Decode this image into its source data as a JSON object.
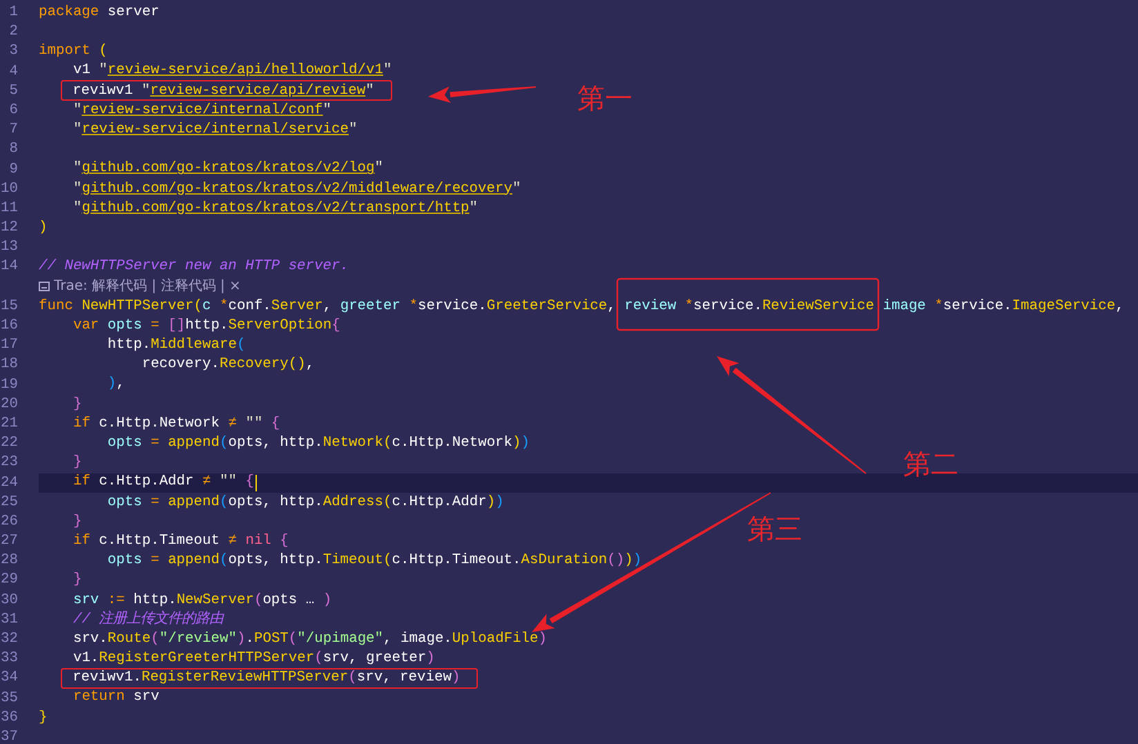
{
  "editor": {
    "lines": [
      {
        "kind": "code",
        "number": "1",
        "current": false,
        "tokens": [
          {
            "kind": "kw",
            "text": "package"
          },
          {
            "kind": "id",
            "text": " server"
          }
        ]
      },
      {
        "kind": "code",
        "number": "2",
        "current": false
      },
      {
        "kind": "code",
        "number": "3",
        "current": false,
        "tokens": [
          {
            "kind": "kw",
            "text": "import"
          },
          {
            "kind": "b1",
            "text": " ("
          }
        ]
      },
      {
        "kind": "code",
        "number": "4",
        "current": false,
        "tokens": [
          {
            "kind": "id",
            "text": "    v1 "
          },
          {
            "kind": "q",
            "text": "\""
          },
          {
            "kind": "link",
            "text": "review-service/api/helloworld/v1"
          },
          {
            "kind": "q",
            "text": "\""
          }
        ]
      },
      {
        "kind": "code",
        "number": "5",
        "current": false,
        "tokens": [
          {
            "kind": "id",
            "text": "    reviwv1 "
          },
          {
            "kind": "q",
            "text": "\""
          },
          {
            "kind": "link",
            "text": "review-service/api/review"
          },
          {
            "kind": "q",
            "text": "\""
          }
        ]
      },
      {
        "kind": "code",
        "number": "6",
        "current": false,
        "tokens": [
          {
            "kind": "q",
            "text": "    \""
          },
          {
            "kind": "link",
            "text": "review-service/internal/conf"
          },
          {
            "kind": "q",
            "text": "\""
          }
        ]
      },
      {
        "kind": "code",
        "number": "7",
        "current": false,
        "tokens": [
          {
            "kind": "q",
            "text": "    \""
          },
          {
            "kind": "link",
            "text": "review-service/internal/service"
          },
          {
            "kind": "q",
            "text": "\""
          }
        ]
      },
      {
        "kind": "code",
        "number": "8",
        "current": false
      },
      {
        "kind": "code",
        "number": "9",
        "current": false,
        "tokens": [
          {
            "kind": "q",
            "text": "    \""
          },
          {
            "kind": "link",
            "text": "github.com/go-kratos/kratos/v2/log"
          },
          {
            "kind": "q",
            "text": "\""
          }
        ]
      },
      {
        "kind": "code",
        "number": "10",
        "current": false,
        "tokens": [
          {
            "kind": "q",
            "text": "    \""
          },
          {
            "kind": "link",
            "text": "github.com/go-kratos/kratos/v2/middleware/recovery"
          },
          {
            "kind": "q",
            "text": "\""
          }
        ]
      },
      {
        "kind": "code",
        "number": "11",
        "current": false,
        "tokens": [
          {
            "kind": "q",
            "text": "    \""
          },
          {
            "kind": "link",
            "text": "github.com/go-kratos/kratos/v2/transport/http"
          },
          {
            "kind": "q",
            "text": "\""
          }
        ]
      },
      {
        "kind": "code",
        "number": "12",
        "current": false,
        "tokens": [
          {
            "kind": "b1",
            "text": ")"
          }
        ]
      },
      {
        "kind": "code",
        "number": "13",
        "current": false
      },
      {
        "kind": "code",
        "number": "14",
        "current": false,
        "tokens": [
          {
            "kind": "cm",
            "text": "// NewHTTPServer new an HTTP server."
          }
        ]
      },
      {
        "kind": "codelens",
        "text": "Trae: 解释代码 | 注释代码 | ×"
      },
      {
        "kind": "code",
        "number": "15",
        "current": false,
        "tokens": [
          {
            "kind": "kw",
            "text": "func"
          },
          {
            "kind": "fn",
            "text": " NewHTTPServer"
          },
          {
            "kind": "b1",
            "text": "("
          },
          {
            "kind": "var",
            "text": "c "
          },
          {
            "kind": "op",
            "text": "*"
          },
          {
            "kind": "id",
            "text": "conf."
          },
          {
            "kind": "fn",
            "text": "Server"
          },
          {
            "kind": "id",
            "text": ", "
          },
          {
            "kind": "var",
            "text": "greeter "
          },
          {
            "kind": "op",
            "text": "*"
          },
          {
            "kind": "id",
            "text": "service."
          },
          {
            "kind": "fn",
            "text": "GreeterService"
          },
          {
            "kind": "id",
            "text": ", "
          },
          {
            "kind": "var",
            "text": "review "
          },
          {
            "kind": "op",
            "text": "*"
          },
          {
            "kind": "id",
            "text": "service."
          },
          {
            "kind": "fn",
            "text": "ReviewService"
          },
          {
            "kind": "var",
            "text": " image "
          },
          {
            "kind": "op",
            "text": "*"
          },
          {
            "kind": "id",
            "text": "service."
          },
          {
            "kind": "fn",
            "text": "ImageService"
          },
          {
            "kind": "id",
            "text": ","
          }
        ]
      },
      {
        "kind": "code",
        "number": "16",
        "current": false,
        "tokens": [
          {
            "kind": "kw",
            "text": "    var"
          },
          {
            "kind": "var",
            "text": " opts "
          },
          {
            "kind": "op",
            "text": "="
          },
          {
            "kind": "b2",
            "text": " []"
          },
          {
            "kind": "id",
            "text": "http."
          },
          {
            "kind": "fn",
            "text": "ServerOption"
          },
          {
            "kind": "b2",
            "text": "{"
          }
        ]
      },
      {
        "kind": "code",
        "number": "17",
        "current": false,
        "tokens": [
          {
            "kind": "id",
            "text": "        http."
          },
          {
            "kind": "fn",
            "text": "Middleware"
          },
          {
            "kind": "b3",
            "text": "("
          }
        ]
      },
      {
        "kind": "code",
        "number": "18",
        "current": false,
        "tokens": [
          {
            "kind": "id",
            "text": "            recovery."
          },
          {
            "kind": "fn",
            "text": "Recovery"
          },
          {
            "kind": "b1",
            "text": "()"
          },
          {
            "kind": "id",
            "text": ","
          }
        ]
      },
      {
        "kind": "code",
        "number": "19",
        "current": false,
        "tokens": [
          {
            "kind": "b3",
            "text": "        )"
          },
          {
            "kind": "id",
            "text": ","
          }
        ]
      },
      {
        "kind": "code",
        "number": "20",
        "current": false,
        "tokens": [
          {
            "kind": "b2",
            "text": "    }"
          }
        ]
      },
      {
        "kind": "code",
        "number": "21",
        "current": false,
        "tokens": [
          {
            "kind": "kw",
            "text": "    if"
          },
          {
            "kind": "id",
            "text": " c.Http.Network "
          },
          {
            "kind": "op",
            "text": "≠"
          },
          {
            "kind": "q",
            "text": " \"\" "
          },
          {
            "kind": "b2",
            "text": "{"
          }
        ]
      },
      {
        "kind": "code",
        "number": "22",
        "current": false,
        "tokens": [
          {
            "kind": "var",
            "text": "        opts "
          },
          {
            "kind": "op",
            "text": "="
          },
          {
            "kind": "fn",
            "text": " append"
          },
          {
            "kind": "b3",
            "text": "("
          },
          {
            "kind": "id",
            "text": "opts, http."
          },
          {
            "kind": "fn",
            "text": "Network"
          },
          {
            "kind": "b1",
            "text": "("
          },
          {
            "kind": "id",
            "text": "c.Http.Network"
          },
          {
            "kind": "b1",
            "text": ")"
          },
          {
            "kind": "b3",
            "text": ")"
          }
        ]
      },
      {
        "kind": "code",
        "number": "23",
        "current": false,
        "tokens": [
          {
            "kind": "b2",
            "text": "    }"
          }
        ]
      },
      {
        "kind": "code",
        "number": "24",
        "current": true,
        "tokens": [
          {
            "kind": "kw",
            "text": "    if"
          },
          {
            "kind": "id",
            "text": " c.Http.Addr "
          },
          {
            "kind": "op",
            "text": "≠"
          },
          {
            "kind": "q",
            "text": " \"\" "
          },
          {
            "kind": "b2",
            "text": "{"
          }
        ]
      },
      {
        "kind": "code",
        "number": "25",
        "current": false,
        "tokens": [
          {
            "kind": "var",
            "text": "        opts "
          },
          {
            "kind": "op",
            "text": "="
          },
          {
            "kind": "fn",
            "text": " append"
          },
          {
            "kind": "b3",
            "text": "("
          },
          {
            "kind": "id",
            "text": "opts, http."
          },
          {
            "kind": "fn",
            "text": "Address"
          },
          {
            "kind": "b1",
            "text": "("
          },
          {
            "kind": "id",
            "text": "c.Http.Addr"
          },
          {
            "kind": "b1",
            "text": ")"
          },
          {
            "kind": "b3",
            "text": ")"
          }
        ]
      },
      {
        "kind": "code",
        "number": "26",
        "current": false,
        "tokens": [
          {
            "kind": "b2",
            "text": "    }"
          }
        ]
      },
      {
        "kind": "code",
        "number": "27",
        "current": false,
        "tokens": [
          {
            "kind": "kw",
            "text": "    if"
          },
          {
            "kind": "id",
            "text": " c.Http.Timeout "
          },
          {
            "kind": "op",
            "text": "≠"
          },
          {
            "kind": "nil",
            "text": " nil"
          },
          {
            "kind": "b2",
            "text": " {"
          }
        ]
      },
      {
        "kind": "code",
        "number": "28",
        "current": false,
        "tokens": [
          {
            "kind": "var",
            "text": "        opts "
          },
          {
            "kind": "op",
            "text": "="
          },
          {
            "kind": "fn",
            "text": " append"
          },
          {
            "kind": "b3",
            "text": "("
          },
          {
            "kind": "id",
            "text": "opts, http."
          },
          {
            "kind": "fn",
            "text": "Timeout"
          },
          {
            "kind": "b1",
            "text": "("
          },
          {
            "kind": "id",
            "text": "c.Http.Timeout."
          },
          {
            "kind": "fn",
            "text": "AsDuration"
          },
          {
            "kind": "b2",
            "text": "()"
          },
          {
            "kind": "b1",
            "text": ")"
          },
          {
            "kind": "b3",
            "text": ")"
          }
        ]
      },
      {
        "kind": "code",
        "number": "29",
        "current": false,
        "tokens": [
          {
            "kind": "b2",
            "text": "    }"
          }
        ]
      },
      {
        "kind": "code",
        "number": "30",
        "current": false,
        "tokens": [
          {
            "kind": "var",
            "text": "    srv "
          },
          {
            "kind": "op",
            "text": ":="
          },
          {
            "kind": "id",
            "text": " http."
          },
          {
            "kind": "fn",
            "text": "NewServer"
          },
          {
            "kind": "b2",
            "text": "("
          },
          {
            "kind": "id",
            "text": "opts … "
          },
          {
            "kind": "b2",
            "text": ")"
          }
        ]
      },
      {
        "kind": "code",
        "number": "31",
        "current": false,
        "tokens": [
          {
            "kind": "cm",
            "text": "    // 注册上传文件的路由"
          }
        ]
      },
      {
        "kind": "code",
        "number": "32",
        "current": false,
        "tokens": [
          {
            "kind": "id",
            "text": "    srv."
          },
          {
            "kind": "fn",
            "text": "Route"
          },
          {
            "kind": "b2",
            "text": "("
          },
          {
            "kind": "str",
            "text": "\"/review\""
          },
          {
            "kind": "b2",
            "text": ")"
          },
          {
            "kind": "id",
            "text": "."
          },
          {
            "kind": "fn",
            "text": "POST"
          },
          {
            "kind": "b2",
            "text": "("
          },
          {
            "kind": "str",
            "text": "\"/upimage\""
          },
          {
            "kind": "id",
            "text": ", image."
          },
          {
            "kind": "fn",
            "text": "UploadFile"
          },
          {
            "kind": "b2",
            "text": ")"
          }
        ]
      },
      {
        "kind": "code",
        "number": "33",
        "current": false,
        "tokens": [
          {
            "kind": "id",
            "text": "    v1."
          },
          {
            "kind": "fn",
            "text": "RegisterGreeterHTTPServer"
          },
          {
            "kind": "b2",
            "text": "("
          },
          {
            "kind": "id",
            "text": "srv, greeter"
          },
          {
            "kind": "b2",
            "text": ")"
          }
        ]
      },
      {
        "kind": "code",
        "number": "34",
        "current": false,
        "tokens": [
          {
            "kind": "id",
            "text": "    reviwv1."
          },
          {
            "kind": "fn",
            "text": "RegisterReviewHTTPServer"
          },
          {
            "kind": "b2",
            "text": "("
          },
          {
            "kind": "id",
            "text": "srv, review"
          },
          {
            "kind": "b2",
            "text": ")"
          }
        ]
      },
      {
        "kind": "code",
        "number": "35",
        "current": false,
        "tokens": [
          {
            "kind": "kw",
            "text": "    return"
          },
          {
            "kind": "id",
            "text": " srv"
          }
        ]
      },
      {
        "kind": "code",
        "number": "36",
        "current": false,
        "tokens": [
          {
            "kind": "b1",
            "text": "}"
          }
        ]
      },
      {
        "kind": "code",
        "number": "37",
        "current": false
      }
    ]
  },
  "annotations": [
    {
      "label": "第一"
    },
    {
      "label": "第二"
    },
    {
      "label": "第三"
    }
  ]
}
